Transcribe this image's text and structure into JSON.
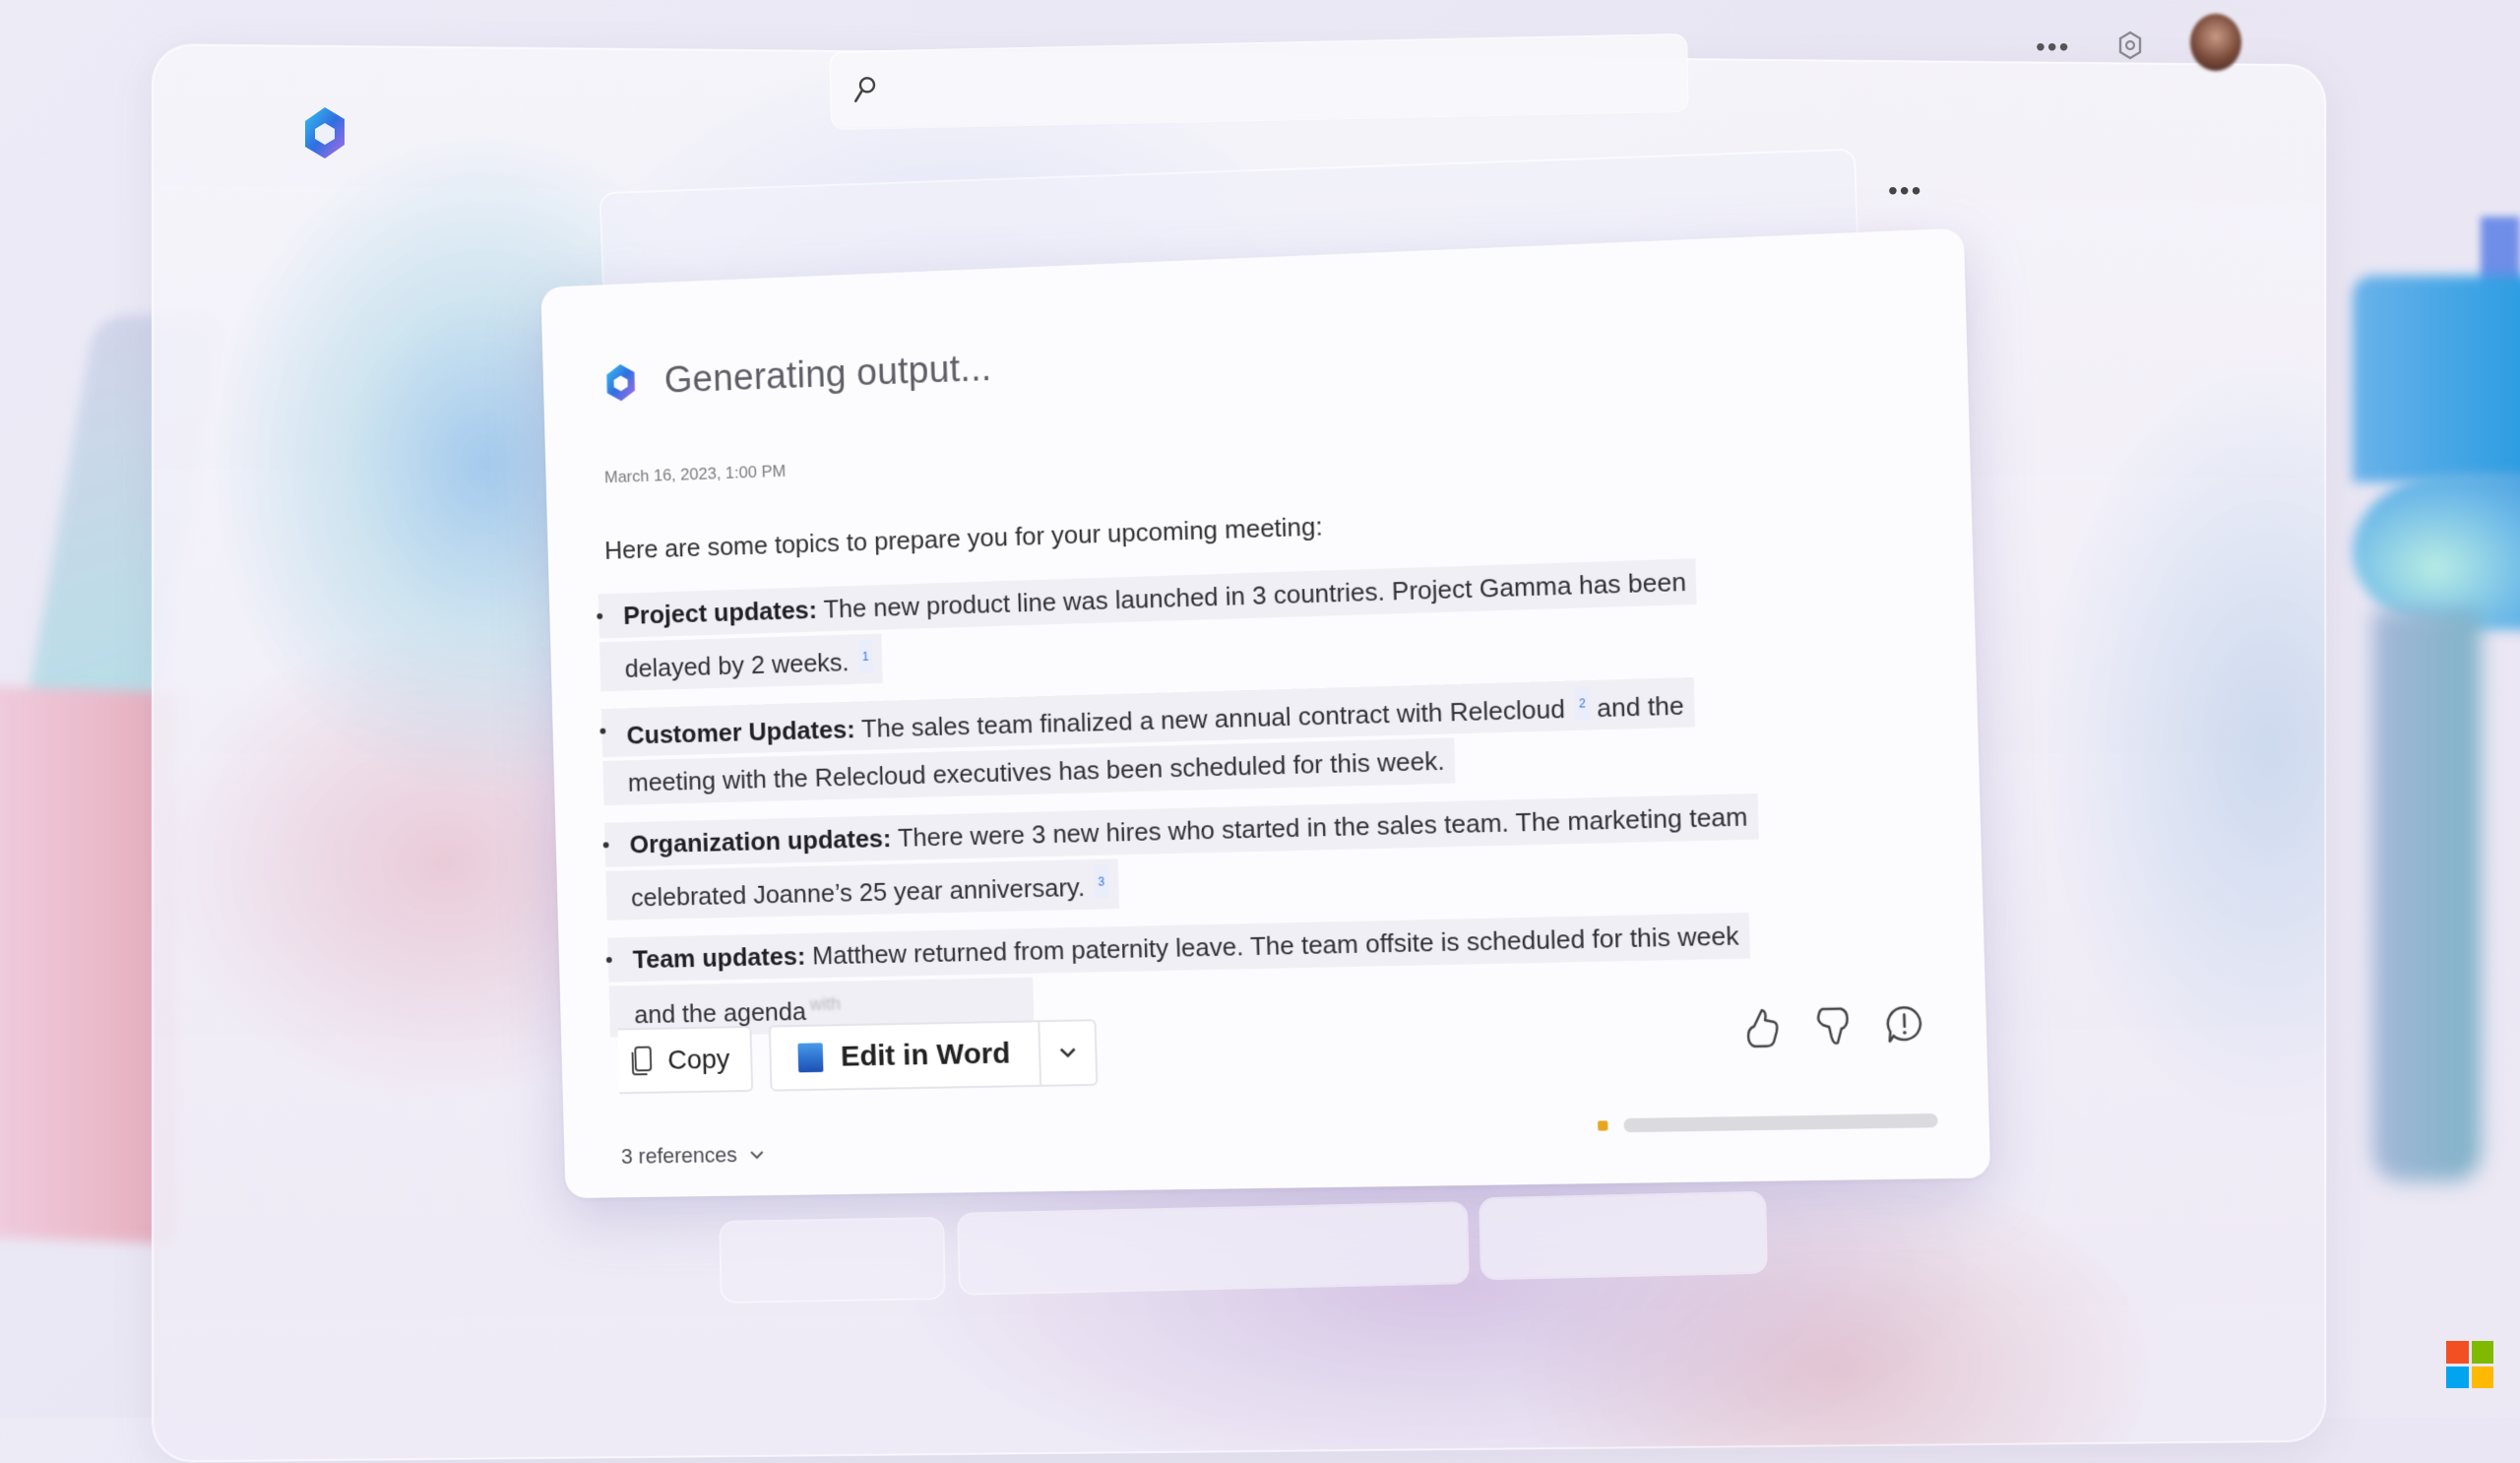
{
  "app": {
    "name": "Microsoft 365 Copilot"
  },
  "header": {
    "search": {
      "placeholder": "",
      "value": ""
    },
    "more_icon": "more-horizontal-icon",
    "settings_icon": "gear-icon",
    "avatar_icon": "user-avatar"
  },
  "prompt_bar": {
    "value": "",
    "more_icon": "more-horizontal-icon"
  },
  "response": {
    "title": "Generating output...",
    "timestamp": "March 16, 2023, 1:00 PM",
    "intro": "Here are some topics to prepare you for your upcoming meeting:",
    "bullets": [
      {
        "label": "Project updates:",
        "line1": " The new product line was launched in 3 countries. Project Gamma has been",
        "line2": "delayed by 2 weeks.",
        "citation": "1"
      },
      {
        "label": "Customer Updates:",
        "line1": " The sales team finalized a new annual contract with Relecloud",
        "citation": "2",
        "line1_tail": "and the",
        "line2": "meeting with the Relecloud executives has been scheduled for this week."
      },
      {
        "label": "Organization updates:",
        "line1": " There were 3 new hires who started in the sales team. The marketing team",
        "line2": "celebrated Joanne’s 25 year anniversary.",
        "citation": "3"
      },
      {
        "label": "Team updates:",
        "line1": " Matthew returned from paternity leave. The team offsite is scheduled for this week",
        "line2": "and the agenda",
        "streaming_word": "with"
      }
    ],
    "actions": {
      "copy_label": "Copy",
      "edit_label": "Edit in Word",
      "dropdown_icon": "chevron-down-icon"
    },
    "feedback": {
      "like_icon": "thumbs-up-icon",
      "dislike_icon": "thumbs-down-icon",
      "report_icon": "feedback-alert-icon"
    },
    "references_label": "3 references",
    "progress": {
      "value_percent": 3,
      "accent": "#e9a520"
    }
  },
  "suggestions": [
    {
      "label": ""
    },
    {
      "label": ""
    },
    {
      "label": ""
    }
  ],
  "colors": {
    "card_bg": "#fcfcfe",
    "word_blue": "#2f74d0",
    "citation_blue": "#3b6fd4",
    "ms_logo": [
      "#f25022",
      "#7fba00",
      "#00a4ef",
      "#ffb900"
    ]
  }
}
